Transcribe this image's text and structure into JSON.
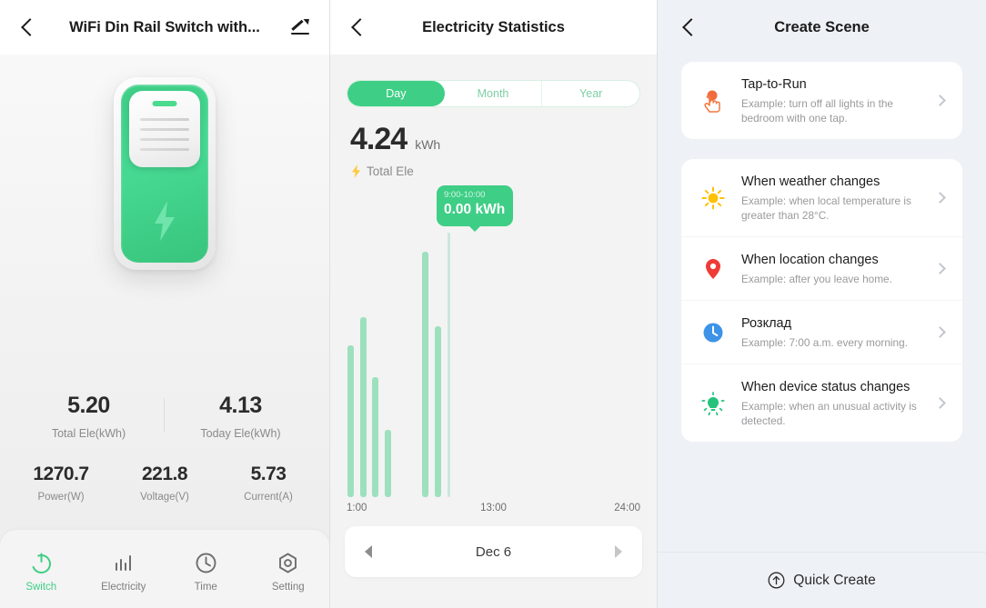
{
  "panel1": {
    "header": {
      "title": "WiFi Din Rail Switch with...",
      "back_icon": "chevron-left-icon",
      "edit_icon": "pencil-edit-icon"
    },
    "device_icon": "din-rail-switch-illustration",
    "stats_primary": [
      {
        "value": "5.20",
        "label": "Total Ele(kWh)"
      },
      {
        "value": "4.13",
        "label": "Today Ele(kWh)"
      }
    ],
    "stats_secondary": [
      {
        "value": "1270.7",
        "label": "Power(W)"
      },
      {
        "value": "221.8",
        "label": "Voltage(V)"
      },
      {
        "value": "5.73",
        "label": "Current(A)"
      }
    ],
    "tabs": [
      {
        "label": "Switch",
        "icon": "power-icon",
        "active": true
      },
      {
        "label": "Electricity",
        "icon": "bar-chart-icon",
        "active": false
      },
      {
        "label": "Time",
        "icon": "clock-icon",
        "active": false
      },
      {
        "label": "Setting",
        "icon": "hex-gear-icon",
        "active": false
      }
    ],
    "accent_color": "#3ece86"
  },
  "panel2": {
    "header": {
      "title": "Electricity Statistics",
      "back_icon": "chevron-left-icon"
    },
    "segments": [
      {
        "label": "Day",
        "active": true
      },
      {
        "label": "Month",
        "active": false
      },
      {
        "label": "Year",
        "active": false
      }
    ],
    "summary": {
      "value": "4.24",
      "unit": "kWh",
      "label": "Total Ele",
      "icon": "lightning-bolt-icon"
    },
    "tooltip": {
      "time": "9:00-10:00",
      "value": "0.00 kWh"
    },
    "date_nav": {
      "label": "Dec 6",
      "prev_icon": "triangle-left-icon",
      "next_icon": "triangle-right-icon"
    },
    "chart_data": {
      "type": "bar",
      "title": "Electricity Statistics",
      "xlabel": "",
      "ylabel": "kWh",
      "categories": [
        "1:00",
        "2:00",
        "3:00",
        "4:00",
        "5:00",
        "6:00",
        "7:00",
        "8:00",
        "9:00",
        "10:00",
        "11:00",
        "12:00",
        "13:00",
        "14:00",
        "15:00",
        "16:00",
        "17:00",
        "18:00",
        "19:00",
        "20:00",
        "21:00",
        "22:00",
        "23:00",
        "24:00"
      ],
      "values": [
        0.63,
        0.75,
        0.5,
        0.28,
        0,
        0,
        1.02,
        0.71,
        0.0,
        0,
        0,
        0,
        0,
        0,
        0,
        0,
        0,
        0,
        0,
        0,
        0,
        0,
        0,
        0
      ],
      "ylim": [
        0,
        1.1
      ],
      "axis_ticks": [
        "1:00",
        "13:00",
        "24:00"
      ],
      "selected_index": 8,
      "selected_label": "9:00-10:00",
      "selected_value": "0.00 kWh",
      "total": 4.24,
      "total_unit": "kWh",
      "grid": false,
      "legend": "none",
      "bar_color": "#9de0bd",
      "selection_color": "#c8e8dd"
    }
  },
  "panel3": {
    "header": {
      "title": "Create Scene",
      "back_icon": "chevron-left-icon"
    },
    "primary_item": {
      "title": "Tap-to-Run",
      "desc": "Example: turn off all lights in the bedroom with one tap.",
      "icon": "tap-hand-icon"
    },
    "items": [
      {
        "title": "When weather changes",
        "desc": "Example: when local temperature is greater than 28°C.",
        "icon": "sun-icon"
      },
      {
        "title": "When location changes",
        "desc": "Example: after you leave home.",
        "icon": "location-pin-icon"
      },
      {
        "title": "Розклад",
        "desc": "Example: 7:00 a.m. every morning.",
        "icon": "clock-blue-icon"
      },
      {
        "title": "When device status changes",
        "desc": "Example: when an unusual activity is detected.",
        "icon": "bulb-icon"
      }
    ],
    "quick_create": {
      "label": "Quick Create",
      "icon": "circle-arrow-up-icon"
    }
  }
}
